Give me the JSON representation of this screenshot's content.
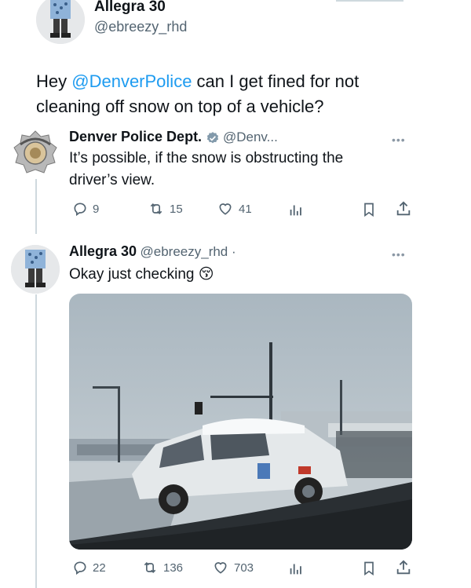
{
  "original_tweet": {
    "display_name": "Allegra 30",
    "handle": "@ebreezy_rhd",
    "text_prefix": "Hey ",
    "mention": "@DenverPolice",
    "text_suffix": " can I get fined for not cleaning off snow on top of a vehicle?"
  },
  "reply_police": {
    "display_name": "Denver Police Dept.",
    "handle": "@Denv...",
    "text": "It’s possible, if the snow is obstructing the driver’s view.",
    "replies": "9",
    "reposts": "15",
    "likes": "41",
    "more_label": "•••"
  },
  "reply_allegra": {
    "display_name": "Allegra 30",
    "handle": "@ebreezy_rhd ·",
    "text": "Okay just checking",
    "emoji": "😚",
    "replies": "22",
    "reposts": "136",
    "likes": "703",
    "more_label": "•••"
  },
  "icons": {
    "reply": "reply-icon",
    "repost": "repost-icon",
    "like": "heart-icon",
    "views": "views-icon",
    "bookmark": "bookmark-icon",
    "share": "share-icon"
  },
  "colors": {
    "accent": "#1d9bf0",
    "muted": "#536471",
    "verified": "#829aab"
  }
}
